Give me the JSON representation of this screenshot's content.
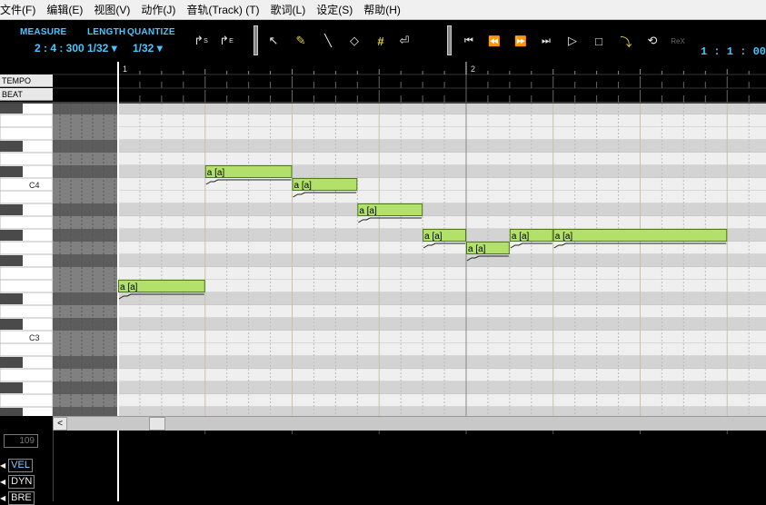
{
  "menu": [
    "文件(F)",
    "编辑(E)",
    "视图(V)",
    "动作(J)",
    "音轨(Track) (T)",
    "歌词(L)",
    "设定(S)",
    "帮助(H)"
  ],
  "toolbar": {
    "measure_label": "MEASURE",
    "measure_value": "2 : 4 : 300",
    "length_label": "LENGTH",
    "length_value": "1/32",
    "quantize_label": "QUANTIZE",
    "quantize_value": "1/32",
    "clock": "1 : 1 : 00",
    "tools": [
      "start-marker-icon",
      "end-marker-icon",
      "arrow-tool-icon",
      "pencil-tool-icon",
      "line-tool-icon",
      "eraser-tool-icon",
      "grid-snap-icon",
      "auto-vibrato-icon"
    ],
    "transport": [
      "rewind-to-start-icon",
      "rewind-icon",
      "fast-forward-icon",
      "forward-to-end-icon",
      "play-icon",
      "stop-icon",
      "record-icon",
      "loop-icon",
      "rewire-icon"
    ]
  },
  "ruler": {
    "tempo_label": "TEMPO",
    "beat_label": "BEAT",
    "measures": [
      "1",
      "2"
    ]
  },
  "keyboard": {
    "c4_label": "C4",
    "c3_label": "C3"
  },
  "notes": [
    {
      "lyric": "a [a]",
      "start_tick": 0,
      "length_ticks": 480,
      "pitch": 52
    },
    {
      "lyric": "a [a]",
      "start_tick": 480,
      "length_ticks": 480,
      "pitch": 61
    },
    {
      "lyric": "a [a]",
      "start_tick": 960,
      "length_ticks": 360,
      "pitch": 60
    },
    {
      "lyric": "a [a]",
      "start_tick": 1320,
      "length_ticks": 360,
      "pitch": 58
    },
    {
      "lyric": "a [a]",
      "start_tick": 1680,
      "length_ticks": 240,
      "pitch": 56
    },
    {
      "lyric": "a [a]",
      "start_tick": 1920,
      "length_ticks": 240,
      "pitch": 55
    },
    {
      "lyric": "a [a]",
      "start_tick": 2160,
      "length_ticks": 240,
      "pitch": 56
    },
    {
      "lyric": "a [a]",
      "start_tick": 2400,
      "length_ticks": 960,
      "pitch": 56
    }
  ],
  "control": {
    "value": "109",
    "options": [
      "VEL",
      "DYN",
      "BRE"
    ]
  },
  "colors": {
    "accent": "#48c6ff",
    "note_fill": "#b2e06a",
    "note_border": "#4e7a1f"
  }
}
